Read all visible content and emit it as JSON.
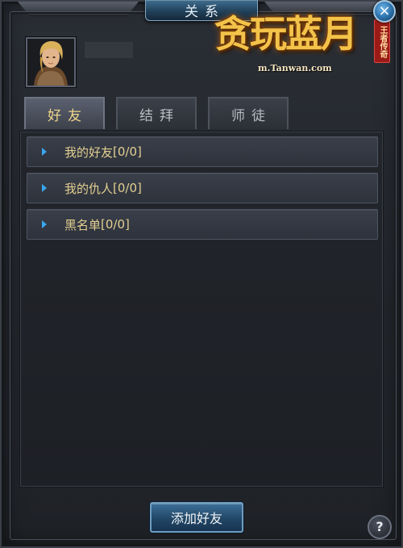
{
  "window": {
    "title": "关系",
    "close_label": "×"
  },
  "logo": {
    "title": "贪玩蓝月",
    "subtitle": "m.Tanwan.com",
    "seal": "王者传奇"
  },
  "tabs": [
    {
      "label": "好友",
      "active": true
    },
    {
      "label": "结拜",
      "active": false
    },
    {
      "label": "师徒",
      "active": false
    }
  ],
  "list": {
    "items": [
      {
        "label": "我的好友",
        "count": "[0/0]"
      },
      {
        "label": "我的仇人",
        "count": "[0/0]"
      },
      {
        "label": "黑名单",
        "count": "[0/0]"
      }
    ]
  },
  "footer": {
    "add_friend_label": "添加好友",
    "help_label": "?"
  },
  "colors": {
    "accent_blue": "#2a6fa8",
    "label_gold": "#e3cf90",
    "chevron_blue": "#3aa6f0"
  }
}
